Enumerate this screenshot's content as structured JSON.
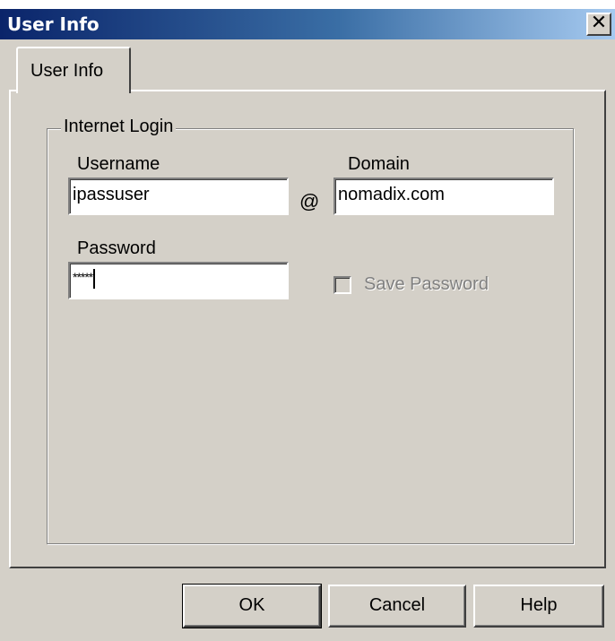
{
  "dialog": {
    "title": "User Info",
    "close_glyph": "✕"
  },
  "tabs": [
    {
      "label": "User Info",
      "selected": true
    }
  ],
  "group": {
    "title": "Internet Login",
    "username_label": "Username",
    "username_value": "ipassuser",
    "at_sign": "@",
    "domain_label": "Domain",
    "domain_value": "nomadix.com",
    "password_label": "Password",
    "password_mask": "*****",
    "save_password_label": "Save Password",
    "save_password_checked": false,
    "save_password_enabled": false
  },
  "buttons": {
    "ok": "OK",
    "cancel": "Cancel",
    "help": "Help"
  },
  "colors": {
    "dialog_face": "#d4d0c8",
    "titlebar_start": "#0a246a",
    "titlebar_end": "#a6caf0",
    "disabled_text": "#808080"
  }
}
